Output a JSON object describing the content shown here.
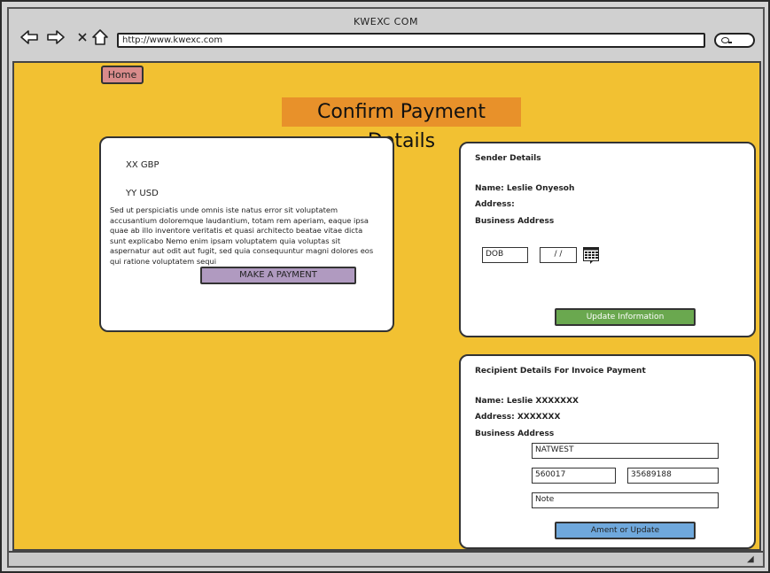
{
  "window": {
    "title": "KWEXC COM",
    "url": "http://www.kwexc.com"
  },
  "nav": {
    "back_icon": "back-arrow-icon",
    "forward_icon": "forward-arrow-icon",
    "close_icon": "close-icon",
    "home_icon": "home-icon",
    "search_icon": "search-icon"
  },
  "page": {
    "home_button": "Home",
    "title": "Confirm Payment Details"
  },
  "payment": {
    "amount_gbp": "XX GBP",
    "amount_usd": "YY USD",
    "description": "Sed ut perspiciatis unde omnis iste natus error sit voluptatem accusantium doloremque laudantium, totam rem aperiam, eaque ipsa quae ab illo inventore veritatis et quasi architecto beatae vitae dicta sunt explicabo Nemo enim ipsam voluptatem quia voluptas sit aspernatur aut odit aut fugit, sed quia consequuntur magni dolores eos qui ratione voluptatem sequi",
    "button": "MAKE A PAYMENT"
  },
  "sender": {
    "title": "Sender Details",
    "name": "Name:  Leslie Onyesoh",
    "address": "Address:",
    "business_address": "Business Address",
    "dob_value": "DOB",
    "date_value": "/ /",
    "button": "Update Information"
  },
  "recipient": {
    "title": "Recipient Details For Invoice Payment",
    "name": "Name:  Leslie XXXXXXX",
    "address": "Address: XXXXXXX",
    "business_address": "Business Address",
    "bank": "NATWEST",
    "sort_code": "560017",
    "account_number": "35689188",
    "note_placeholder": "Note",
    "button": "Ament or Update"
  },
  "colors": {
    "background": "#f2c132",
    "title_highlight": "#e8912a",
    "home_button": "#d98b8b",
    "payment_button": "#b09ac0",
    "update_button": "#6aa84f",
    "ament_button": "#6fa8dc"
  }
}
